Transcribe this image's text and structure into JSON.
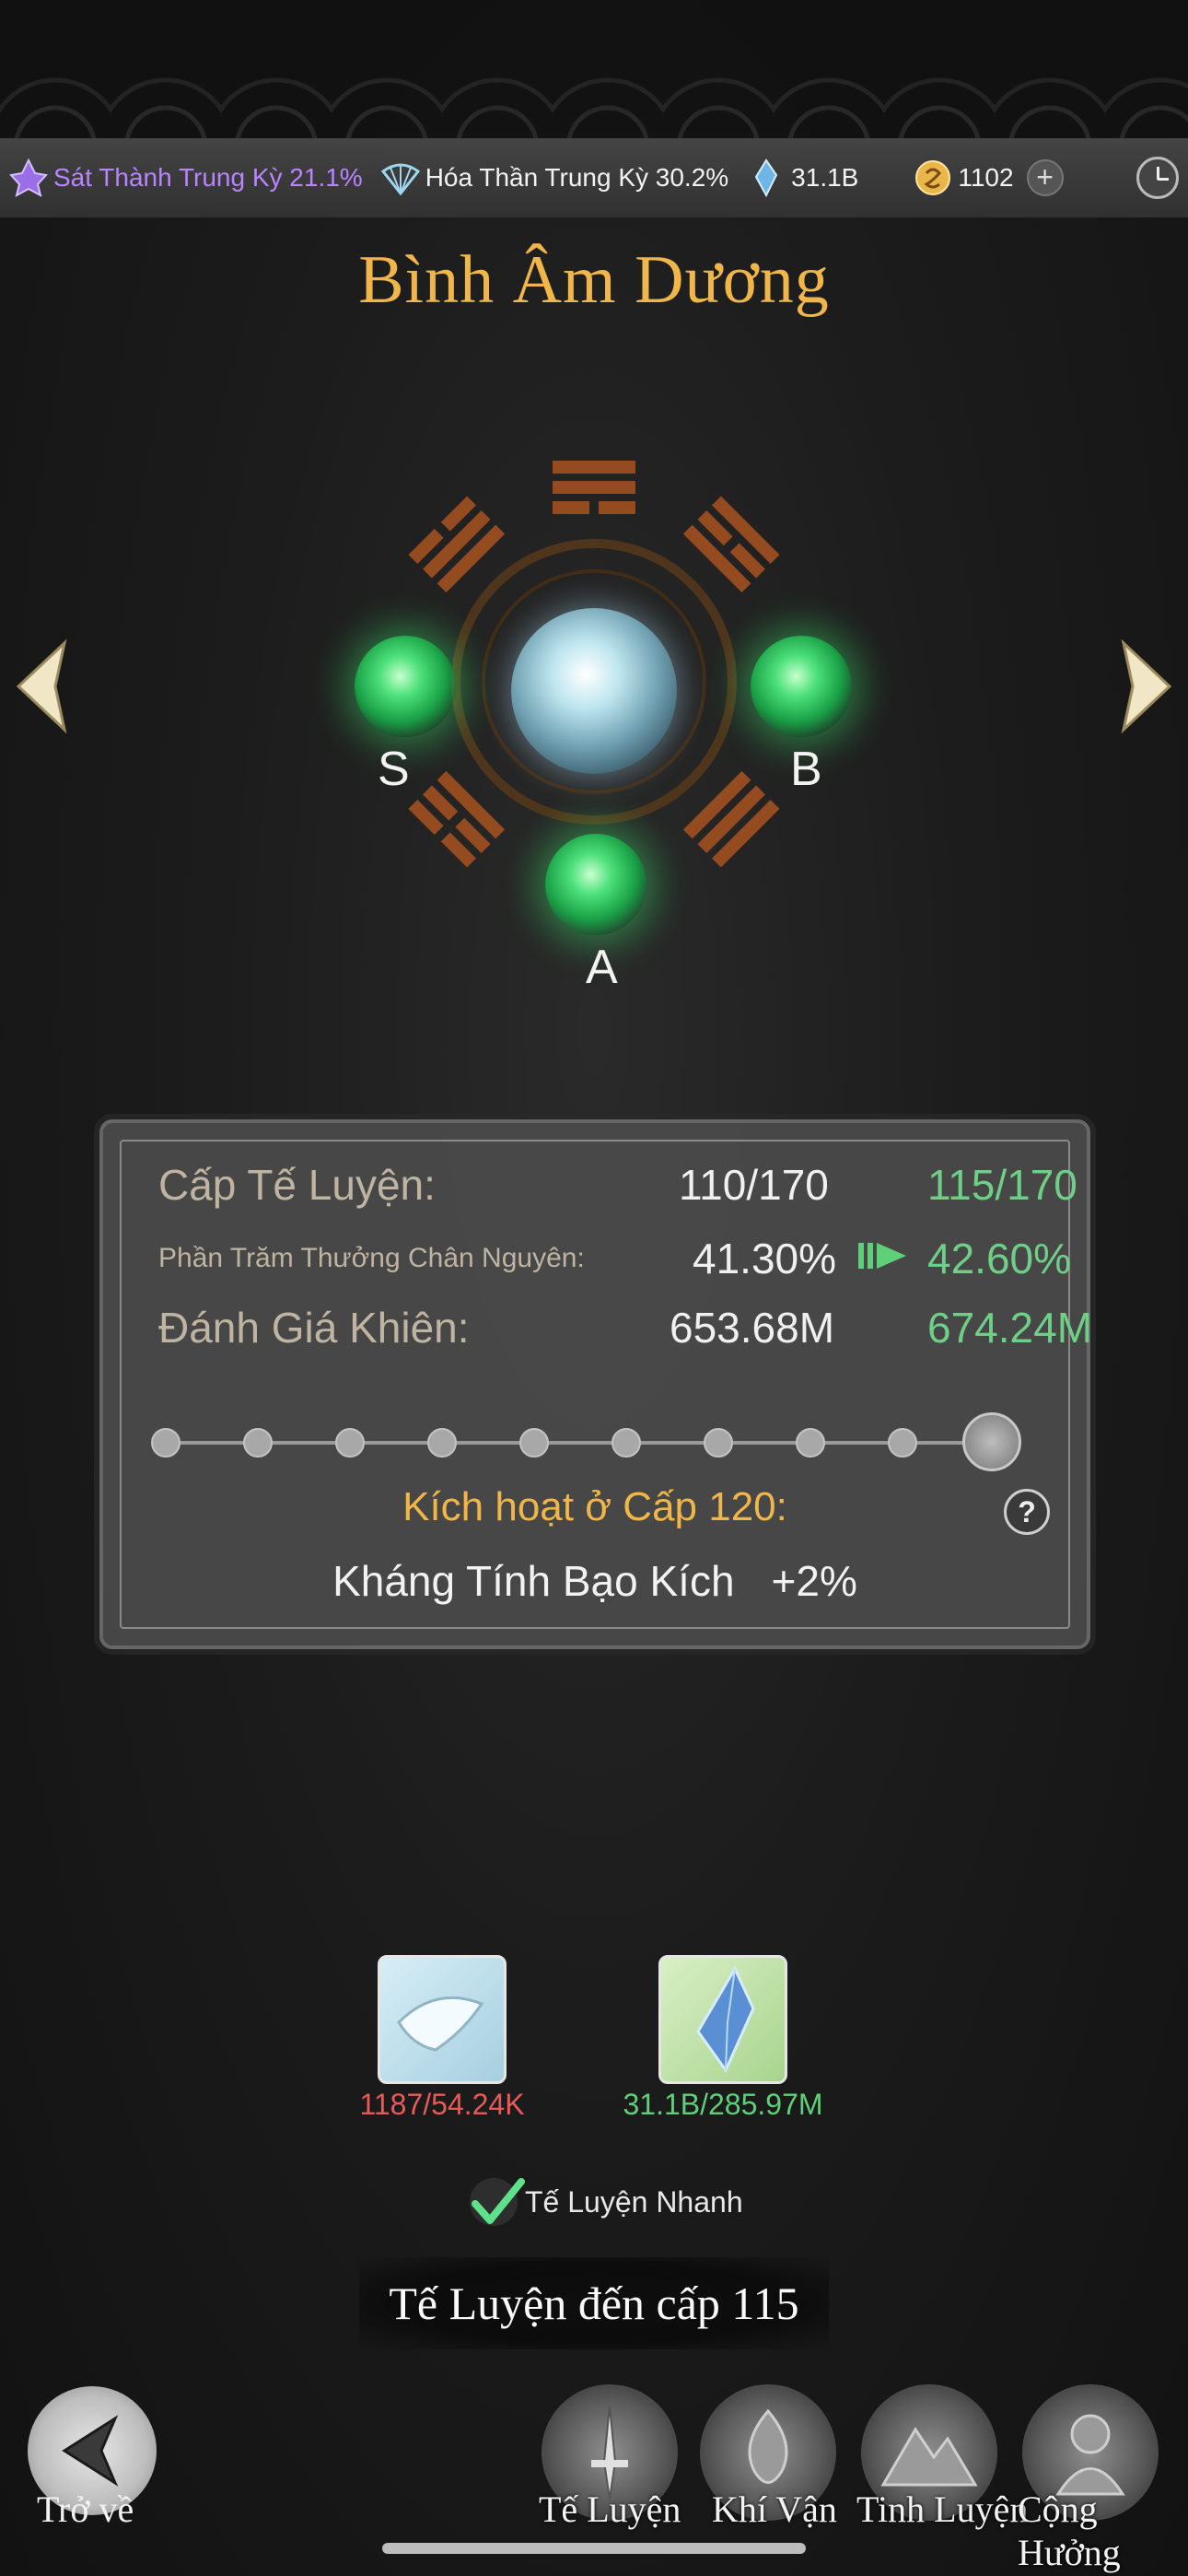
{
  "status_bar": {
    "stat1": "Sát Thành Trung Kỳ 21.1%",
    "stat2": "Hóa Thần Trung Kỳ 30.2%",
    "crystal_amount": "31.1B",
    "coin_amount": "1102",
    "icons": [
      "cultivation-icon",
      "fan-icon",
      "crystal-icon",
      "coin-icon",
      "plus-icon",
      "clock-icon"
    ]
  },
  "title": "Bình Âm Dương",
  "orbs": {
    "left_label": "S",
    "right_label": "B",
    "bottom_label": "A"
  },
  "panel": {
    "level_label": "Cấp Tế Luyện:",
    "level_current": "110/170",
    "level_next": "115/170",
    "bonus_label": "Phần Trăm Thưởng Chân Nguyên:",
    "bonus_current": "41.30%",
    "bonus_next": "42.60%",
    "rating_label": "Đánh Giá Khiên:",
    "rating_current": "653.68M",
    "rating_next": "674.24M",
    "progress_total_dots": 10,
    "activate_text": "Kích hoạt ở Cấp 120:",
    "effect_name": "Kháng Tính Bạo Kích",
    "effect_value": "+2%",
    "help_label": "?"
  },
  "materials": {
    "item1_count": "1187/54.24K",
    "item2_count": "31.1B/285.97M"
  },
  "quick_refine_label": "Tế Luyện Nhanh",
  "main_button": "Tế Luyện đến cấp 115",
  "bottom_nav": {
    "back": "Trở về",
    "tab1": "Tế Luyện",
    "tab2": "Khí Vận",
    "tab3": "Tinh Luyện",
    "tab4": "Cộng Hưởng"
  },
  "colors": {
    "title_gold": "#f0b64a",
    "next_green": "#6fcf86",
    "deficit_red": "#e85a5a",
    "purple_stat": "#b884ff"
  }
}
